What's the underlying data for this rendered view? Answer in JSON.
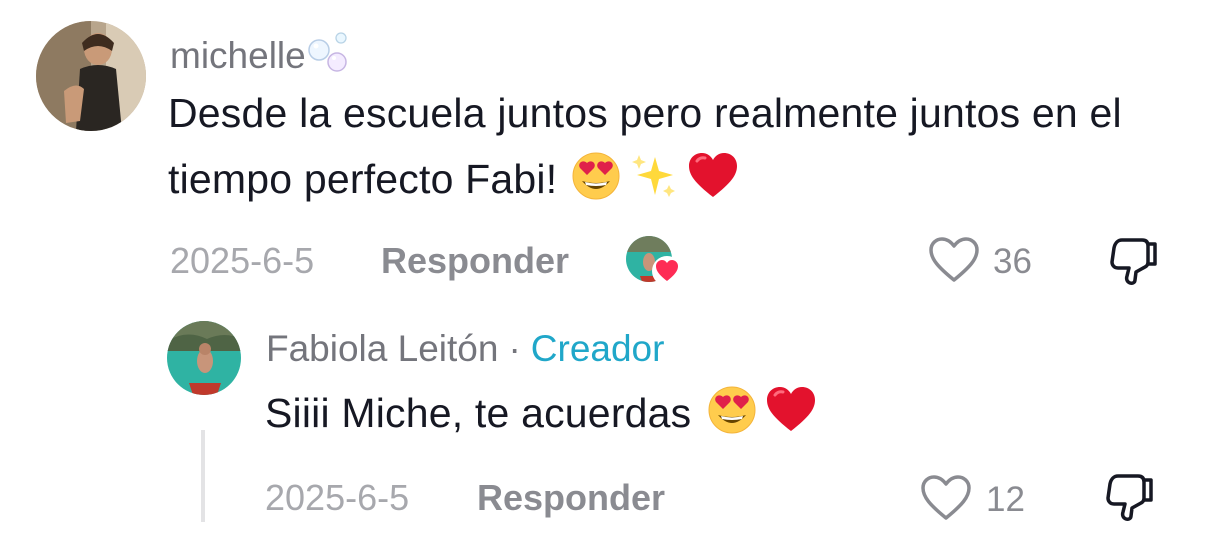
{
  "comment": {
    "username": "michelle",
    "username_emoji_icon": "bubbles-icon",
    "text": "Desde la escuela juntos pero realmente juntos en el tiempo perfecto Fabi!",
    "text_emojis": [
      "heart-eyes-emoji",
      "sparkles-emoji",
      "red-heart-emoji"
    ],
    "date": "2025-6-5",
    "reply_label": "Responder",
    "liked_by_creator_icon": "creator-avatar-heart-badge",
    "like_count": "36"
  },
  "reply": {
    "username": "Fabiola Leitón",
    "separator": "·",
    "creator_label": "Creador",
    "text": "Siiii Miche, te acuerdas",
    "text_emojis": [
      "heart-eyes-emoji",
      "red-heart-emoji"
    ],
    "date": "2025-6-5",
    "reply_label": "Responder",
    "like_count": "12"
  },
  "colors": {
    "text": "#161823",
    "secondary": "#8a8b91",
    "date": "#a7a8ad",
    "creator": "#20a7c9",
    "heart_badge": "#fe2c55"
  }
}
